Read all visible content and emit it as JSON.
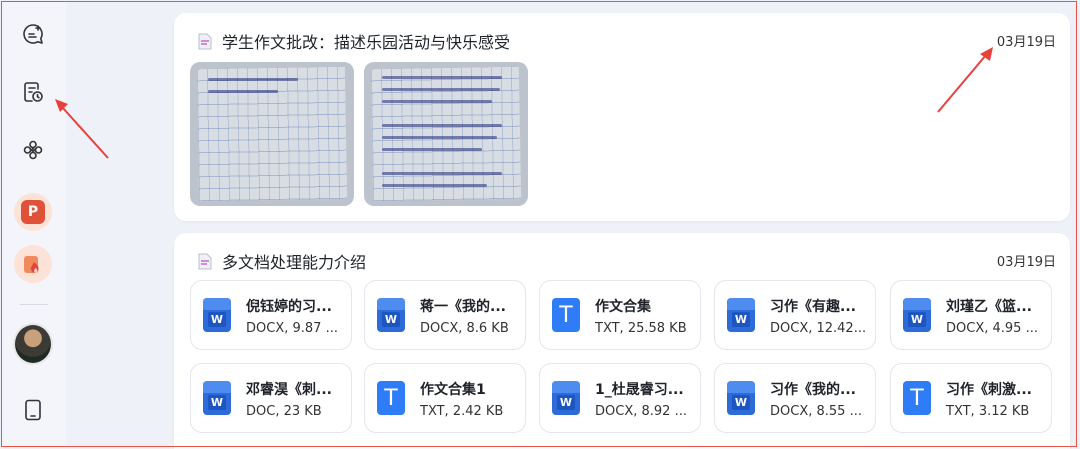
{
  "colors": {
    "accent_red": "#e8534a",
    "word_blue": "#2d6bd9",
    "txt_blue": "#2e7df6"
  },
  "sidebar": {
    "items": [
      {
        "name": "new-chat-icon"
      },
      {
        "name": "history-icon"
      },
      {
        "name": "apps-icon"
      },
      {
        "name": "ppt-app-icon",
        "letter": "P"
      },
      {
        "name": "fire-app-icon"
      },
      {
        "name": "avatar"
      },
      {
        "name": "device-icon"
      }
    ]
  },
  "history": {
    "card1": {
      "title": "学生作文批改：描述乐园活动与快乐感受",
      "date": "03月19日"
    },
    "card2": {
      "title": "多文档处理能力介绍",
      "date": "03月19日",
      "files": [
        {
          "name": "倪钰婷的习...",
          "meta": "DOCX, 9.87 ...",
          "type": "word"
        },
        {
          "name": "蒋一《我的...",
          "meta": "DOCX, 8.6 KB",
          "type": "word"
        },
        {
          "name": "作文合集",
          "meta": "TXT, 25.58 KB",
          "type": "txt"
        },
        {
          "name": "习作《有趣...",
          "meta": "DOCX, 12.42...",
          "type": "word"
        },
        {
          "name": "刘瑾乙《篮...",
          "meta": "DOCX, 4.95 ...",
          "type": "word"
        },
        {
          "name": "邓睿淏《刺...",
          "meta": "DOC, 23 KB",
          "type": "word"
        },
        {
          "name": "作文合集1",
          "meta": "TXT, 2.42 KB",
          "type": "txt"
        },
        {
          "name": "1_杜晟睿习...",
          "meta": "DOCX, 8.92 ...",
          "type": "word"
        },
        {
          "name": "习作《我的...",
          "meta": "DOCX, 8.55 ...",
          "type": "word"
        },
        {
          "name": "习作《刺激...",
          "meta": "TXT, 3.12 KB",
          "type": "txt"
        }
      ]
    }
  },
  "file_icon_labels": {
    "word": "W",
    "txt": "T"
  }
}
